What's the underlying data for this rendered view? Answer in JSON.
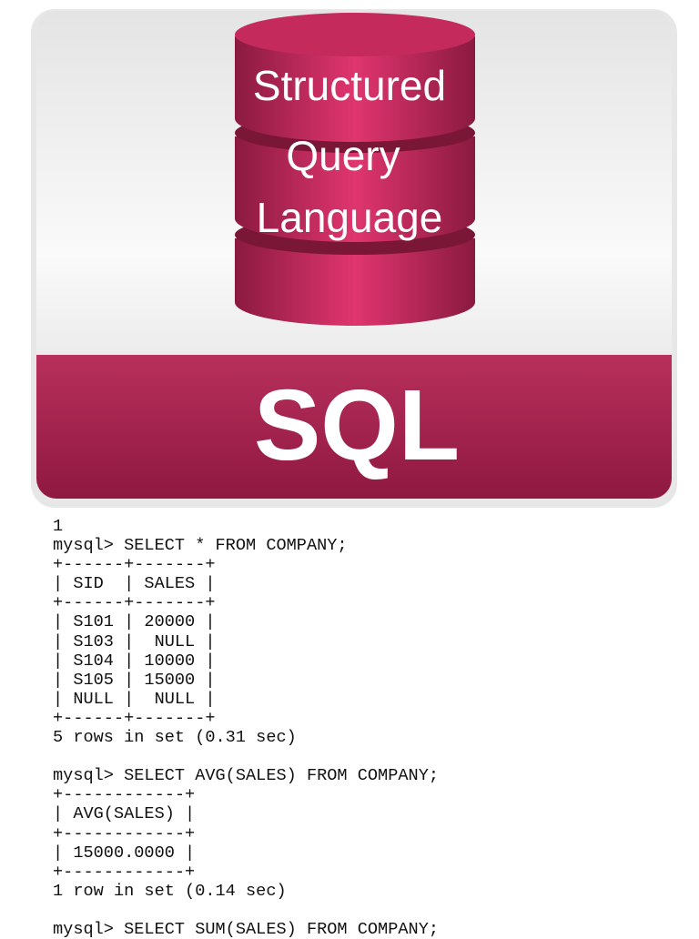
{
  "logo": {
    "title_lines": [
      "Structured",
      "Query",
      "Language"
    ],
    "label": "SQL",
    "colors": {
      "crimson": "#a3204d",
      "crimson_light": "#d9306b",
      "card": "#f3f3f3"
    }
  },
  "terminal": {
    "lines": [
      "1",
      "mysql> SELECT * FROM COMPANY;",
      "+------+-------+",
      "| SID  | SALES |",
      "+------+-------+",
      "| S101 | 20000 |",
      "| S103 |  NULL |",
      "| S104 | 10000 |",
      "| S105 | 15000 |",
      "| NULL |  NULL |",
      "+------+-------+",
      "5 rows in set (0.31 sec)",
      "",
      "mysql> SELECT AVG(SALES) FROM COMPANY;",
      "+------------+",
      "| AVG(SALES) |",
      "+------------+",
      "| 15000.0000 |",
      "+------------+",
      "1 row in set (0.14 sec)",
      "",
      "mysql> SELECT SUM(SALES) FROM COMPANY;"
    ]
  }
}
